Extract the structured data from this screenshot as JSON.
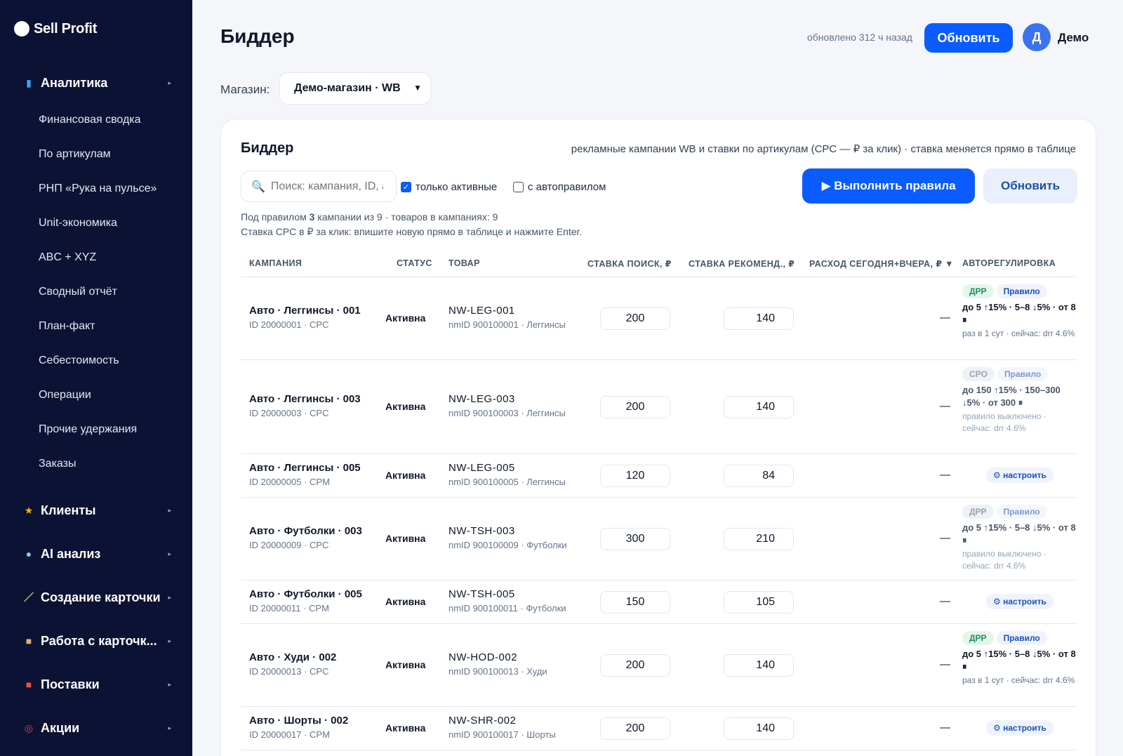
{
  "app": {
    "logo": "Sell Profit"
  },
  "sidebar": {
    "groups": [
      {
        "label": "Аналитика",
        "icon": "bar-chart-icon"
      },
      {
        "label": "Клиенты",
        "icon": "star-icon"
      },
      {
        "label": "AI анализ",
        "icon": "robot-icon"
      },
      {
        "label": "Создание карточки",
        "icon": "magic-wand-icon"
      },
      {
        "label": "Работа с карточк...",
        "icon": "folder-icon"
      },
      {
        "label": "Поставки",
        "icon": "truck-icon"
      },
      {
        "label": "Акции",
        "icon": "target-icon"
      }
    ],
    "analytics_items": [
      "Финансовая сводка",
      "По артикулам",
      "РНП «Рука на пульсе»",
      "Unit-экономика",
      "ABC + XYZ",
      "Сводный отчёт",
      "План-факт",
      "Себестоимость",
      "Операции",
      "Прочие удержания",
      "Заказы"
    ]
  },
  "header": {
    "title": "Биддер",
    "updated": "обновлено 312 ч назад",
    "refresh_label": "Обновить",
    "avatar_letter": "Д",
    "user_name": "Демо"
  },
  "store": {
    "label": "Магазин:",
    "selected": "Демо-магазин · WB"
  },
  "panel": {
    "title": "Биддер",
    "subtitle": "рекламные кампании WB и ставки по артикулам (CPC — ₽ за клик) · ставка меняется прямо в таблице",
    "search_placeholder": "Поиск: кампания, ID, артикул",
    "only_active_label": "только активные",
    "only_active_checked": true,
    "with_autorule_label": "с автоправилом",
    "with_autorule_checked": false,
    "run_rules_label": "▶ Выполнить правила",
    "refresh_label": "Обновить",
    "note_prefix": "Под правилом ",
    "note_count": "3",
    "note_suffix": " кампании из 9 · товаров в кампаниях: 9",
    "note2": "Ставка CPC в ₽ за клик: впишите новую прямо в таблице и нажмите Enter."
  },
  "table": {
    "headers": {
      "campaign": "КАМПАНИЯ",
      "status": "СТАТУС",
      "product": "ТОВАР",
      "bid_search": "СТАВКА ПОИСК, ₽",
      "bid_rec": "СТАВКА РЕКОМЕНД., ₽",
      "spend": "РАСХОД СЕГОДНЯ+ВЧЕРА, ₽ ▼",
      "auto": "АВТОРЕГУЛИРОВКА"
    },
    "rows": [
      {
        "name": "Авто · Леггинсы · 001",
        "id": "ID 20000001 · CPC",
        "status": "Активна",
        "sku": "NW-LEG-001",
        "product_sub": "nmID 900100001 · Леггинсы",
        "bid_search": "200",
        "bid_rec": "140",
        "spend": "—",
        "auto": {
          "kind": "rule",
          "tag": "ДРР",
          "tag_state": "on",
          "rule_label": "Правило",
          "text": "до 5 ↑15% · 5–8 ↓5% · от 8 ⏸",
          "note": "раз в 1 сут · сейчас: drr 4.6%"
        }
      },
      {
        "name": "Авто · Леггинсы · 003",
        "id": "ID 20000003 · CPC",
        "status": "Активна",
        "sku": "NW-LEG-003",
        "product_sub": "nmID 900100003 · Леггинсы",
        "bid_search": "200",
        "bid_rec": "140",
        "spend": "—",
        "auto": {
          "kind": "rule",
          "tag": "CPO",
          "tag_state": "off",
          "rule_label": "Правило",
          "text": "до 150 ↑15% · 150–300 ↓5% · от 300 ⏸",
          "note": "правило выключено · сейчас: drr 4.6%"
        }
      },
      {
        "name": "Авто · Леггинсы · 005",
        "id": "ID 20000005 · CPM",
        "status": "Активна",
        "sku": "NW-LEG-005",
        "product_sub": "nmID 900100005 · Леггинсы",
        "bid_search": "120",
        "bid_rec": "84",
        "spend": "—",
        "auto": {
          "kind": "setup",
          "label": "⚙ настроить"
        }
      },
      {
        "name": "Авто · Футболки · 003",
        "id": "ID 20000009 · CPC",
        "status": "Активна",
        "sku": "NW-TSH-003",
        "product_sub": "nmID 900100009 · Футболки",
        "bid_search": "300",
        "bid_rec": "210",
        "spend": "—",
        "auto": {
          "kind": "rule",
          "tag": "ДРР",
          "tag_state": "off",
          "rule_label": "Правило",
          "text": "до 5 ↑15% · 5–8 ↓5% · от 8 ⏸",
          "note": "правило выключено · сейчас: drr 4.6%"
        }
      },
      {
        "name": "Авто · Футболки · 005",
        "id": "ID 20000011 · CPM",
        "status": "Активна",
        "sku": "NW-TSH-005",
        "product_sub": "nmID 900100011 · Футболки",
        "bid_search": "150",
        "bid_rec": "105",
        "spend": "—",
        "auto": {
          "kind": "setup",
          "label": "⚙ настроить"
        }
      },
      {
        "name": "Авто · Худи · 002",
        "id": "ID 20000013 · CPC",
        "status": "Активна",
        "sku": "NW-HOD-002",
        "product_sub": "nmID 900100013 · Худи",
        "bid_search": "200",
        "bid_rec": "140",
        "spend": "—",
        "auto": {
          "kind": "rule",
          "tag": "ДРР",
          "tag_state": "on",
          "rule_label": "Правило",
          "text": "до 5 ↑15% · 5–8 ↓5% · от 8 ⏸",
          "note": "раз в 1 сут · сейчас: drr 4.6%"
        }
      },
      {
        "name": "Авто · Шорты · 002",
        "id": "ID 20000017 · CPM",
        "status": "Активна",
        "sku": "NW-SHR-002",
        "product_sub": "nmID 900100017 · Шорты",
        "bid_search": "200",
        "bid_rec": "140",
        "spend": "—",
        "auto": {
          "kind": "setup",
          "label": "⚙ настроить"
        }
      }
    ]
  },
  "colors": {
    "sidebar_bg": "#0c1233",
    "accent": "#0a5cff",
    "page_bg": "#f4f6fa"
  }
}
